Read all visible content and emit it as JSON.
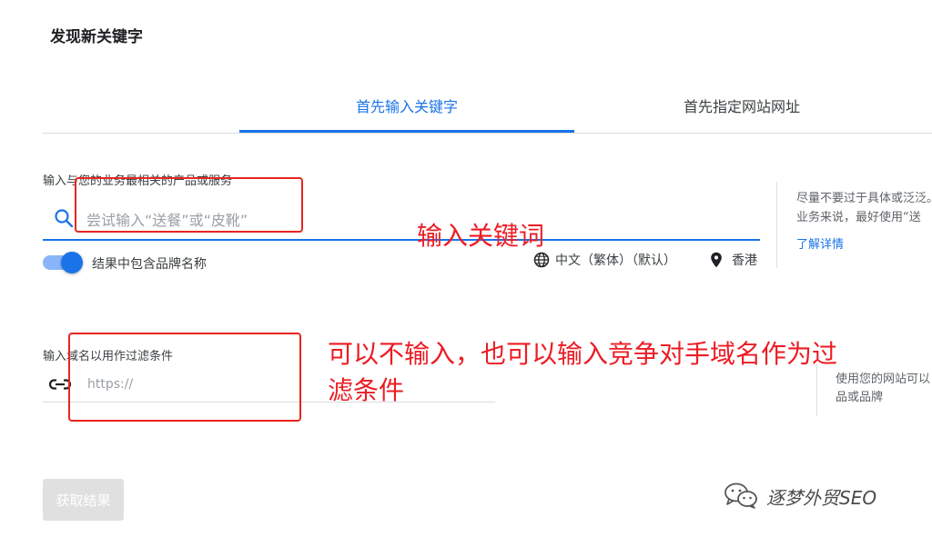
{
  "page": {
    "title": "发现新关键字"
  },
  "tabs": [
    {
      "label": "首先输入关键字",
      "active": true
    },
    {
      "label": "首先指定网站网址",
      "active": false
    }
  ],
  "keyword_section": {
    "label": "输入与您的业务最相关的产品或服务",
    "placeholder": "尝试输入“送餐”或“皮靴”",
    "value": "",
    "brand_toggle_label": "结果中包含品牌名称",
    "brand_toggle_on": true,
    "language": "中文（繁体）（默认）",
    "location": "香港",
    "tip": [
      "尽量不要过于具体或泛泛。",
      "业务来说，最好使用“送"
    ],
    "learn_more": "了解详情"
  },
  "domain_section": {
    "label": "输入域名以用作过滤条件",
    "placeholder": "https://",
    "value": "",
    "tip": [
      "使用您的网站可以",
      "品或品牌"
    ]
  },
  "submit_label": "获取结果",
  "annotations": {
    "keyword_note": "输入关键词",
    "domain_note_line1": "可以不输入，也可以输入竞争对手域名作为过",
    "domain_note_line2": "滤条件"
  },
  "watermark": {
    "text": "逐梦外贸SEO",
    "icon": "wechat-icon"
  },
  "colors": {
    "accent": "#1a73e8",
    "annotation": "#ec1c24",
    "disabled_button": "#e0e0e0"
  }
}
